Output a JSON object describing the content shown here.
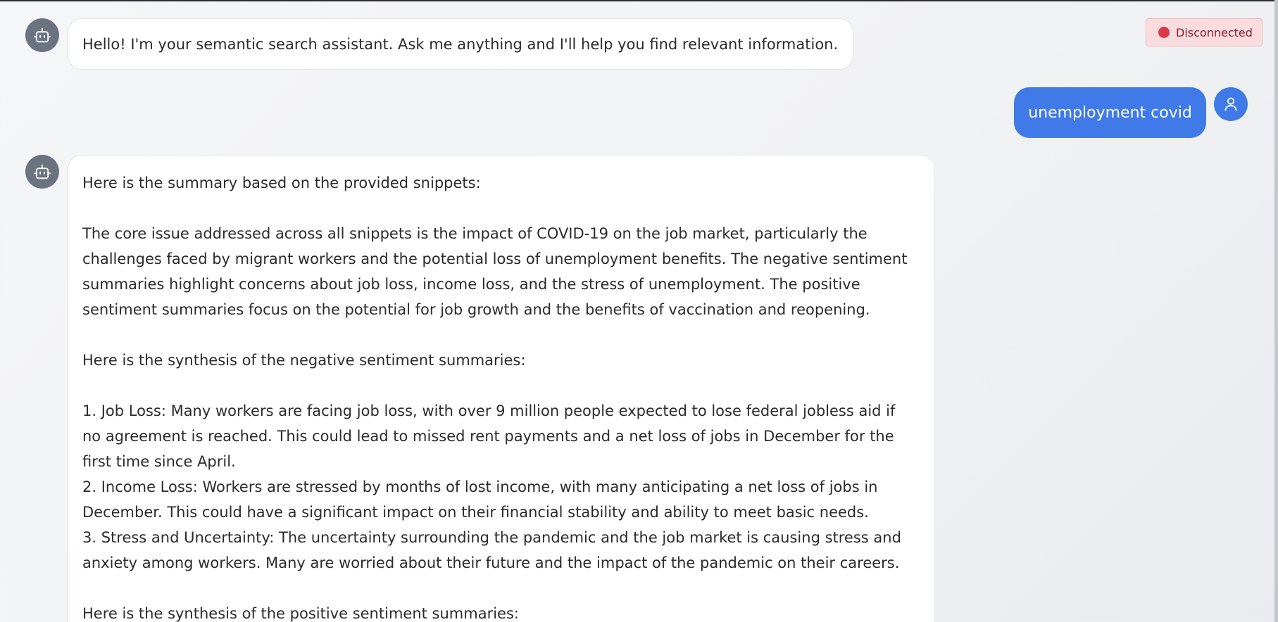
{
  "status": {
    "label": "Disconnected",
    "color": "#d8394b"
  },
  "messages": {
    "greeting": "Hello! I'm your semantic search assistant. Ask me anything and I'll help you find relevant information.",
    "user_query": "unemployment covid",
    "response": {
      "p1": "Here is the summary based on the provided snippets:",
      "p2": [
        "The core issue addressed across all snippets is the impact of COVID-19 on the job market, particularly the",
        "challenges faced by migrant workers and the potential loss of unemployment benefits. The negative sentiment",
        "summaries highlight concerns about job loss, income loss, and the stress of unemployment. The positive",
        "sentiment summaries focus on the potential for job growth and the benefits of vaccination and reopening."
      ],
      "p3": "Here is the synthesis of the negative sentiment summaries:",
      "p4": [
        "1. Job Loss: Many workers are facing job loss, with over 9 million people expected to lose federal jobless aid if",
        "no agreement is reached. This could lead to missed rent payments and a net loss of jobs in December for the",
        "first time since April.",
        "2. Income Loss: Workers are stressed by months of lost income, with many anticipating a net loss of jobs in",
        "December. This could have a significant impact on their financial stability and ability to meet basic needs.",
        "3. Stress and Uncertainty: The uncertainty surrounding the pandemic and the job market is causing stress and",
        "anxiety among workers. Many are worried about their future and the impact of the pandemic on their careers."
      ],
      "p5": "Here is the synthesis of the positive sentiment summaries:"
    }
  },
  "icons": {
    "bot": "robot-icon",
    "user": "user-icon",
    "status": "status-dot"
  },
  "colors": {
    "accent": "#3f7ae8",
    "bot_avatar": "#6b7280",
    "status_bg": "#fadcdf",
    "status_text": "#8f1e2c"
  }
}
